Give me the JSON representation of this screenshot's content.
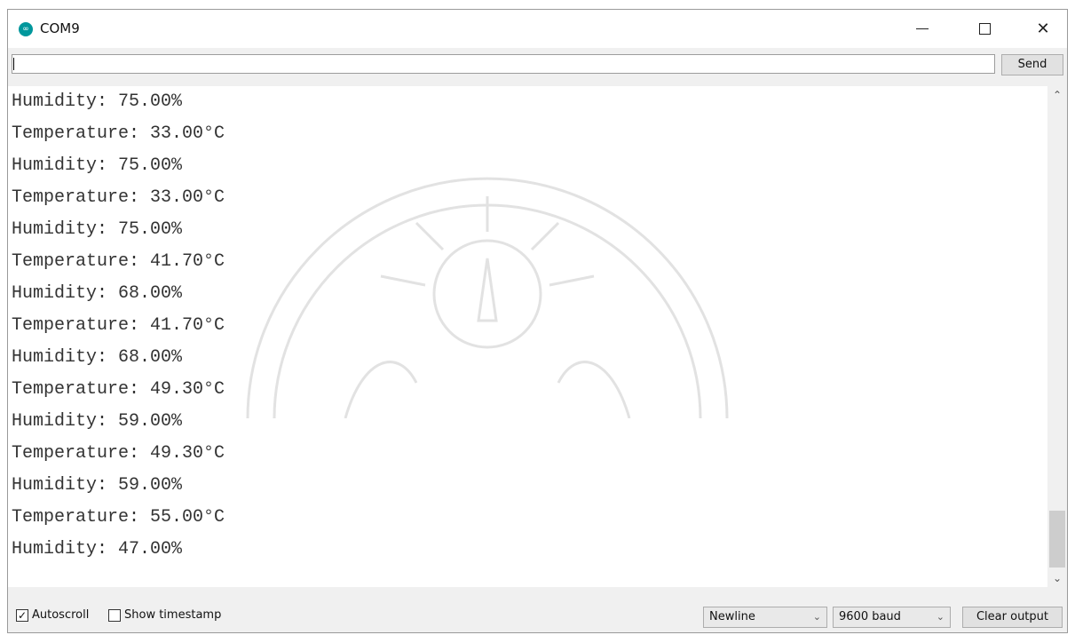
{
  "window": {
    "title": "COM9",
    "app_icon_glyph": "∞",
    "controls": {
      "minimize": "minimize-icon",
      "maximize": "maximize-icon",
      "close": "close-icon",
      "close_glyph": "✕"
    }
  },
  "send_row": {
    "input_value": "",
    "send_label": "Send"
  },
  "output": {
    "lines": [
      "Humidity: 75.00%",
      "Temperature: 33.00°C",
      "Humidity: 75.00%",
      "Temperature: 33.00°C",
      "Humidity: 75.00%",
      "Temperature: 41.70°C",
      "Humidity: 68.00%",
      "Temperature: 41.70°C",
      "Humidity: 68.00%",
      "Temperature: 49.30°C",
      "Humidity: 59.00%",
      "Temperature: 49.30°C",
      "Humidity: 59.00%",
      "Temperature: 55.00°C",
      "Humidity: 47.00%"
    ]
  },
  "scrollbar": {
    "up_glyph": "⌃",
    "down_glyph": "⌄",
    "position_fraction": 0.9
  },
  "bottom_bar": {
    "autoscroll_label": "Autoscroll",
    "autoscroll_checked": true,
    "autoscroll_check_glyph": "✓",
    "timestamp_label": "Show timestamp",
    "timestamp_checked": false,
    "line_ending": "Newline",
    "baud_rate": "9600 baud",
    "chevron_glyph": "⌄",
    "clear_label": "Clear output"
  },
  "colors": {
    "app_icon": "#00979c",
    "window_bg": "#f0f0f0",
    "output_bg": "#ffffff"
  }
}
